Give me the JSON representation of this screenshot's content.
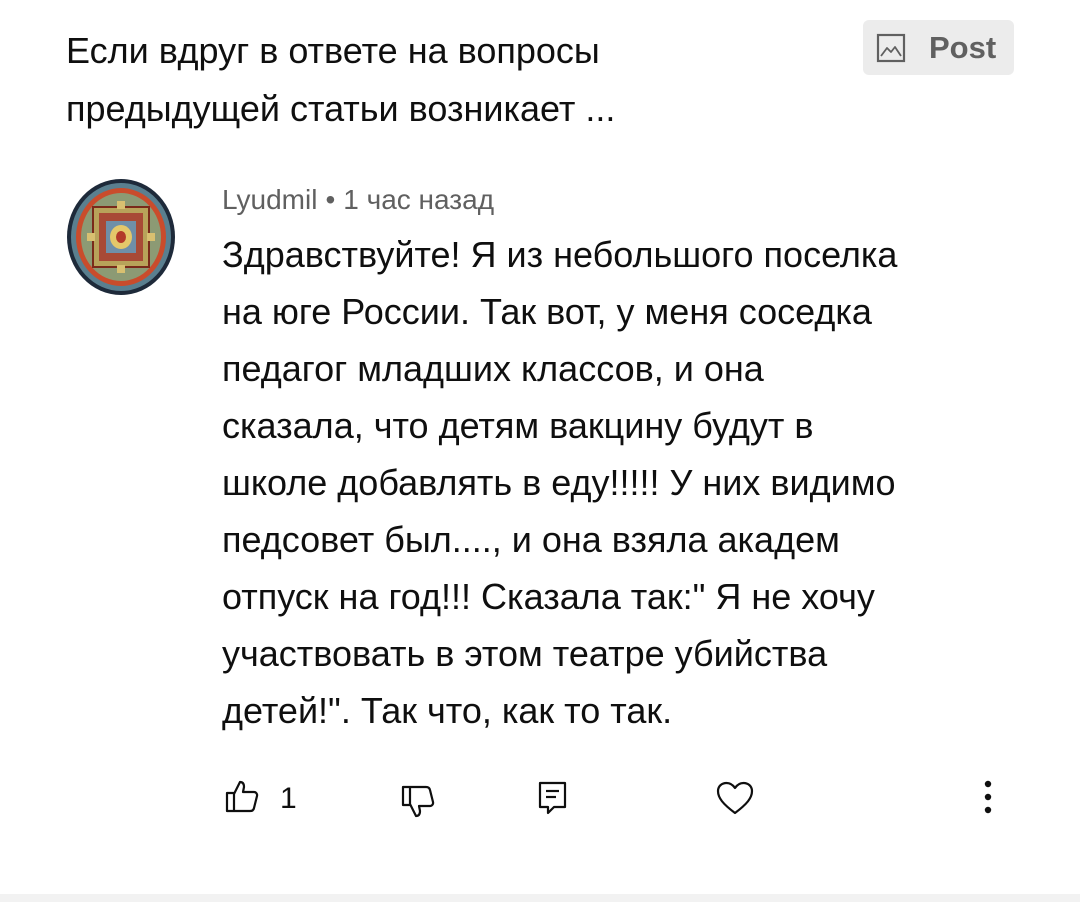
{
  "post": {
    "snippet": "Если вдруг в ответе на вопросы\nпредыдущей статьи возникает ...",
    "post_button_label": "Post",
    "post_button_icon": "image-icon"
  },
  "comment": {
    "author": "Lyudmil",
    "separator": "•",
    "time": "1 час назад",
    "text": "Здравствуйте! Я из небольшого поселка\nна юге России. Так вот, у меня соседка\nпедагог младших классов, и она\nсказала, что детям вакцину будут в\nшколе добавлять в еду!!!!! У них видимо\nпедсовет был...., и она взяла академ\nотпуск на год!!! Сказала так:\" Я не хочу\nучаствовать в этом театре убийства\nдетей!\". Так что, как то так.",
    "like_count": "1"
  },
  "actions": {
    "like_icon": "thumbs-up-icon",
    "dislike_icon": "thumbs-down-icon",
    "reply_icon": "reply-comment-icon",
    "heart_icon": "heart-icon",
    "more_icon": "more-vertical-icon"
  },
  "colors": {
    "text_primary": "#0f0f0f",
    "text_secondary": "#606060",
    "button_bg": "#ececec"
  }
}
